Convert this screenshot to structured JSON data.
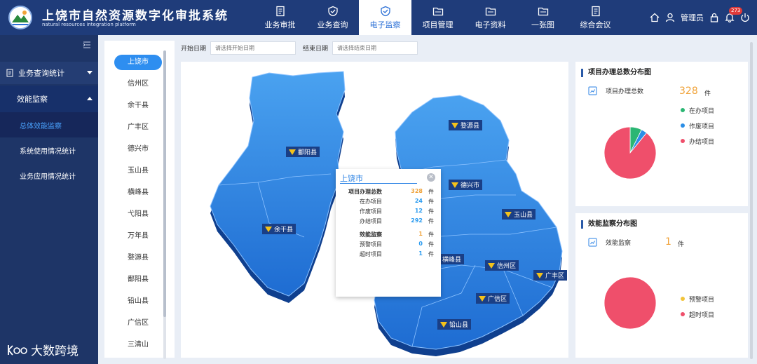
{
  "header": {
    "title": "上饶市自然资源数字化审批系统",
    "subtitle": "natural resources integration platform",
    "nav": [
      {
        "label": "业务审批",
        "icon": "doc-icon",
        "active": false
      },
      {
        "label": "业务查询",
        "icon": "check-shield-icon",
        "active": false
      },
      {
        "label": "电子监察",
        "icon": "monitor-shield-icon",
        "active": true
      },
      {
        "label": "项目管理",
        "icon": "folder-icon",
        "active": false
      },
      {
        "label": "电子资料",
        "icon": "folder-icon",
        "active": false
      },
      {
        "label": "一张图",
        "icon": "folder-icon",
        "active": false
      },
      {
        "label": "综合会议",
        "icon": "doc-icon",
        "active": false
      }
    ],
    "user_label": "管理员",
    "notification_count": "273"
  },
  "sidebar": {
    "group": "业务查询统计",
    "sub": "效能监察",
    "items": [
      "总体效能监察",
      "系统使用情况统计",
      "业务应用情况统计"
    ],
    "watermark": "大数跨境"
  },
  "filters": {
    "start_label": "开始日期",
    "start_placeholder": "请选择开始日期",
    "end_label": "结束日期",
    "end_placeholder": "请选择结束日期"
  },
  "regions": [
    "上饶市",
    "信州区",
    "余干县",
    "广丰区",
    "德兴市",
    "玉山县",
    "横峰县",
    "弋阳县",
    "万年县",
    "婺源县",
    "鄱阳县",
    "铅山县",
    "广信区",
    "三清山"
  ],
  "map_labels": [
    "婺源县",
    "鄱阳县",
    "德兴市",
    "玉山县",
    "余干县",
    "横峰县",
    "信州区",
    "广丰区",
    "广信区",
    "铅山县"
  ],
  "popup": {
    "title": "上饶市",
    "rows": [
      {
        "label": "项目办理总数",
        "value": "328",
        "unit": "件"
      },
      {
        "label": "在办项目",
        "value": "24",
        "unit": "件"
      },
      {
        "label": "作废项目",
        "value": "12",
        "unit": "件"
      },
      {
        "label": "办结项目",
        "value": "292",
        "unit": "件"
      },
      {
        "label": "效能监察",
        "value": "1",
        "unit": "件"
      },
      {
        "label": "预警项目",
        "value": "0",
        "unit": "件"
      },
      {
        "label": "超时项目",
        "value": "1",
        "unit": "件"
      }
    ]
  },
  "card1": {
    "title": "项目办理总数分布图",
    "stat_label": "项目办理总数",
    "stat_value": "328",
    "stat_unit": "件",
    "legend": [
      {
        "label": "在办项目",
        "color": "#2bb673"
      },
      {
        "label": "作废项目",
        "color": "#2b8ee6"
      },
      {
        "label": "办结项目",
        "color": "#ef4f6b"
      }
    ]
  },
  "card2": {
    "title": "效能监察分布图",
    "stat_label": "效能监察",
    "stat_value": "1",
    "stat_unit": "件",
    "legend": [
      {
        "label": "预警项目",
        "color": "#f2c43a"
      },
      {
        "label": "超时项目",
        "color": "#ef4f6b"
      }
    ]
  },
  "chart_data": [
    {
      "type": "pie",
      "categories": [
        "在办项目",
        "作废项目",
        "办结项目"
      ],
      "values": [
        24,
        12,
        292
      ]
    },
    {
      "type": "pie",
      "categories": [
        "预警项目",
        "超时项目"
      ],
      "values": [
        0,
        1
      ]
    }
  ]
}
